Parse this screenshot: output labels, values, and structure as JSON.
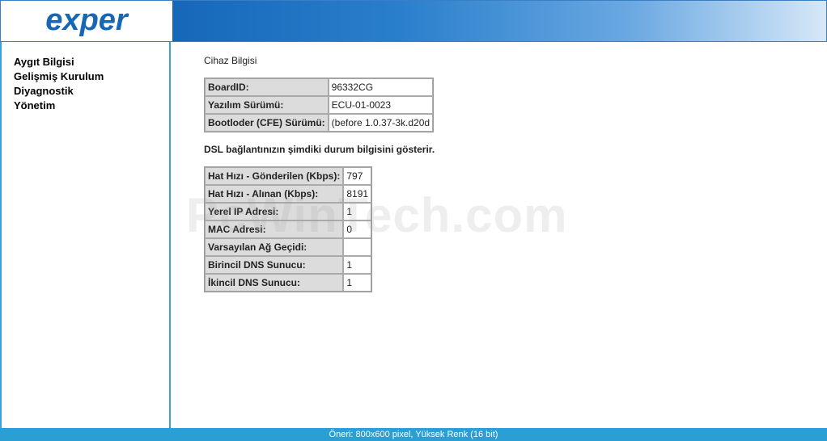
{
  "brand": {
    "logo_text": "exper",
    "logo_color": "#1668b5",
    "accent_color": "#3aa3d6"
  },
  "sidebar": {
    "items": [
      "Aygıt Bilgisi",
      "Gelişmiş Kurulum",
      "Diyagnostik",
      "Yönetim"
    ]
  },
  "device_info": {
    "title": "Cihaz Bilgisi",
    "rows": [
      {
        "label": "BoardID:",
        "value": "96332CG"
      },
      {
        "label": "Yazılım Sürümü:",
        "value": "ECU-01-0023"
      },
      {
        "label": "Bootloder (CFE) Sürümü:",
        "value": "(before 1.0.37-3k.d20d"
      }
    ]
  },
  "dsl_info": {
    "description": "DSL bağlantınızın şimdiki durum bilgisini gösterir.",
    "rows": [
      {
        "label": "Hat Hızı - Gönderilen (Kbps):",
        "value": "797"
      },
      {
        "label": "Hat Hızı - Alınan (Kbps):",
        "value": "8191"
      },
      {
        "label": "Yerel IP Adresi:",
        "value": "1"
      },
      {
        "label": "MAC Adresi:",
        "value": "0"
      },
      {
        "label": "Varsayılan Ağ Geçidi:",
        "value": ""
      },
      {
        "label": "Birincil DNS Sunucu:",
        "value": "1"
      },
      {
        "label": "İkincil DNS Sunucu:",
        "value": "1"
      }
    ]
  },
  "footer": {
    "text": "Öneri: 800x600 pixel, Yüksek Renk (16 bit)"
  },
  "watermark": {
    "text": "PcWinTech.com"
  }
}
